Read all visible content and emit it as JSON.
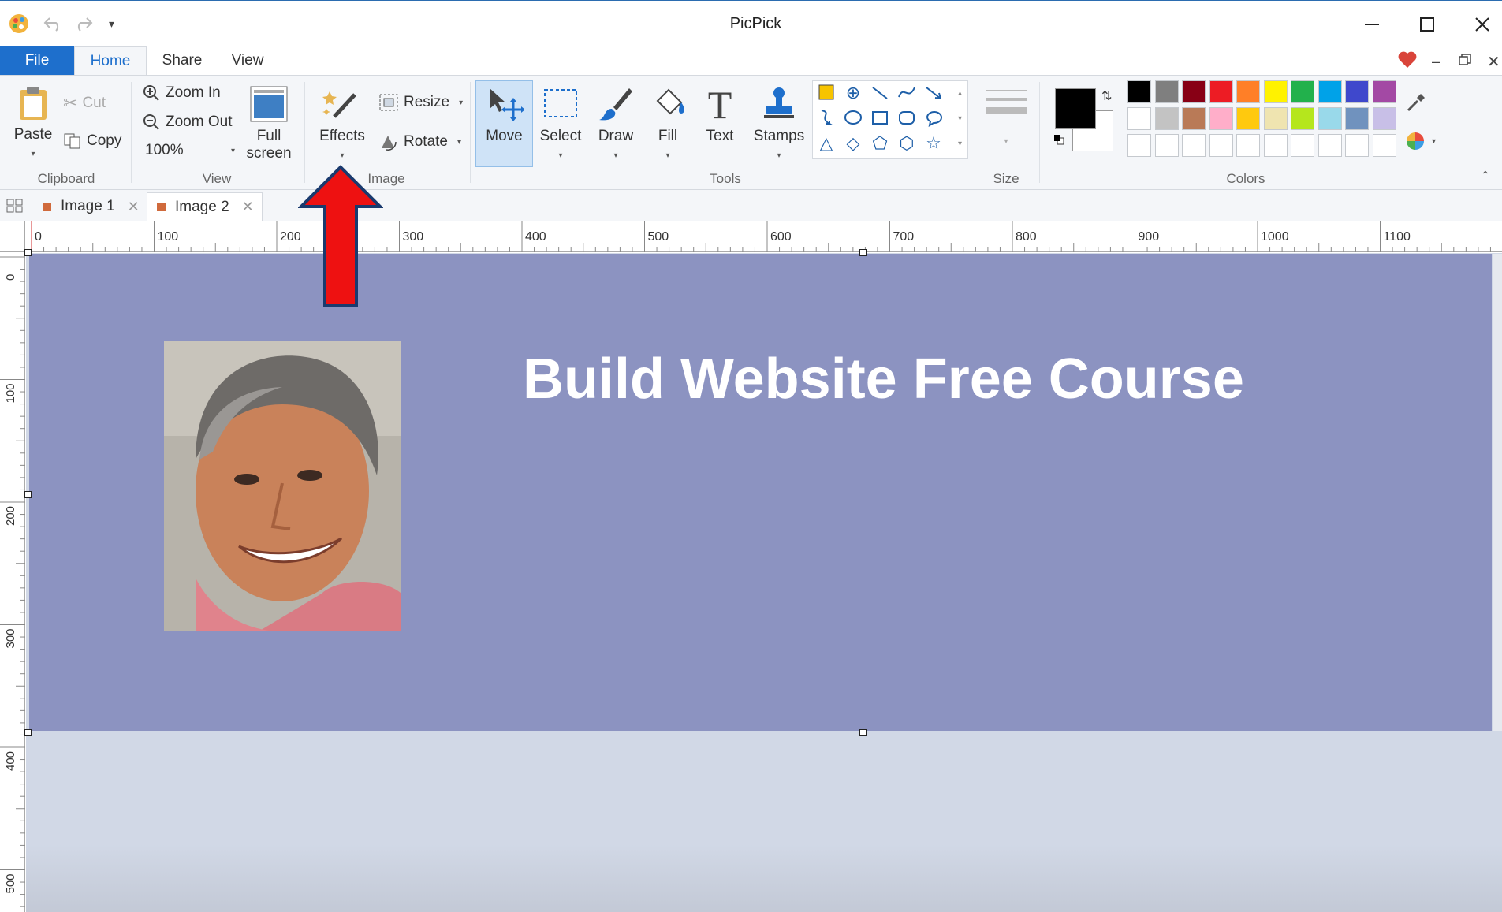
{
  "window": {
    "title": "PicPick"
  },
  "menu": {
    "file": "File",
    "tabs": [
      "Home",
      "Share",
      "View"
    ],
    "active_tab": "Home"
  },
  "ribbon": {
    "clipboard": {
      "group": "Clipboard",
      "paste": "Paste",
      "cut": "Cut",
      "copy": "Copy"
    },
    "view": {
      "group": "View",
      "zoom_in": "Zoom In",
      "zoom_out": "Zoom Out",
      "zoom_level": "100%",
      "full_screen": "Full\nscreen",
      "full_screen_l1": "Full",
      "full_screen_l2": "screen"
    },
    "image": {
      "group": "Image",
      "effects": "Effects",
      "resize": "Resize",
      "rotate": "Rotate"
    },
    "tools": {
      "group": "Tools",
      "move": "Move",
      "select": "Select",
      "draw": "Draw",
      "fill": "Fill",
      "text": "Text",
      "stamps": "Stamps"
    },
    "size": {
      "group": "Size"
    },
    "colors": {
      "group": "Colors",
      "primary": "#000000",
      "secondary": "#ffffff",
      "row1": [
        "#000000",
        "#7f7f7f",
        "#880015",
        "#ed1c24",
        "#ff7f27",
        "#fff200",
        "#22b14c",
        "#00a2e8",
        "#3f48cc",
        "#a349a4"
      ],
      "row2": [
        "#ffffff",
        "#c3c3c3",
        "#b97a57",
        "#ffaec9",
        "#ffc90e",
        "#efe4b0",
        "#b5e61d",
        "#99d9ea",
        "#7092be",
        "#c8bfe7"
      ],
      "row3": [
        "#ffffff",
        "#ffffff",
        "#ffffff",
        "#ffffff",
        "#ffffff",
        "#ffffff",
        "#ffffff",
        "#ffffff",
        "#ffffff",
        "#ffffff"
      ]
    }
  },
  "doc_tabs": [
    {
      "label": "Image 1",
      "active": false
    },
    {
      "label": "Image 2",
      "active": true
    }
  ],
  "ruler": {
    "h": [
      "0",
      "100",
      "200",
      "300",
      "400",
      "500",
      "600",
      "700",
      "800",
      "900",
      "1000",
      "1100"
    ],
    "v": [
      "0",
      "100",
      "200",
      "300",
      "400",
      "500"
    ]
  },
  "canvas": {
    "headline": "Build Website Free Course",
    "banner_color": "#8c93c1"
  },
  "annotation": {
    "arrow_color": "#ee1111"
  }
}
